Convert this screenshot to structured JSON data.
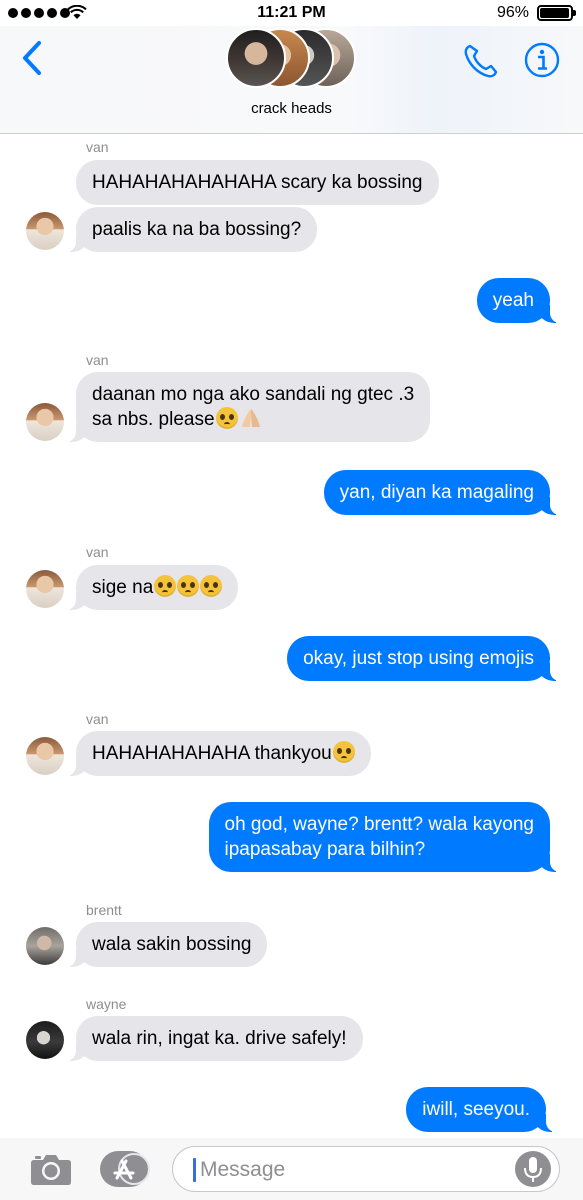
{
  "status": {
    "time": "11:21 PM",
    "battery": "96%",
    "battery_level": 0.96
  },
  "header": {
    "group_name": "crack heads"
  },
  "messages": [
    {
      "sender": "van",
      "text": "HAHAHAHAHAHAHA scary ka bossing"
    },
    {
      "text": "paalis ka na ba bossing?"
    },
    {
      "text": "yeah"
    },
    {
      "sender": "van",
      "line1": "daanan mo nga ako sandali ng gtec .3",
      "line2": "sa nbs. please"
    },
    {
      "text": "yan, diyan ka magaling"
    },
    {
      "sender": "van",
      "text": "sige na"
    },
    {
      "text": "okay, just stop using emojis"
    },
    {
      "sender": "van",
      "text": "HAHAHAHAHAHA thankyou"
    },
    {
      "line1": "oh god, wayne? brentt? wala kayong",
      "line2": "ipapasabay para bilhin?"
    },
    {
      "sender": "brentt",
      "text": "wala sakin bossing"
    },
    {
      "sender": "wayne",
      "text": "wala rin, ingat ka. drive safely!"
    },
    {
      "text": "iwill, seeyou."
    }
  ],
  "composer": {
    "placeholder": "Message"
  },
  "icons": {
    "back": "chevron-left-icon",
    "call": "phone-icon",
    "info": "info-icon",
    "camera": "camera-icon",
    "app_store": "app-store-icon",
    "mic": "microphone-icon",
    "emoji_pleading": "pleading-face-emoji",
    "emoji_pray": "folded-hands-emoji"
  },
  "colors": {
    "accent": "#007aff",
    "incoming": "#e5e5ea",
    "outgoing": "#007aff",
    "secondary_text": "#8e8e93"
  }
}
